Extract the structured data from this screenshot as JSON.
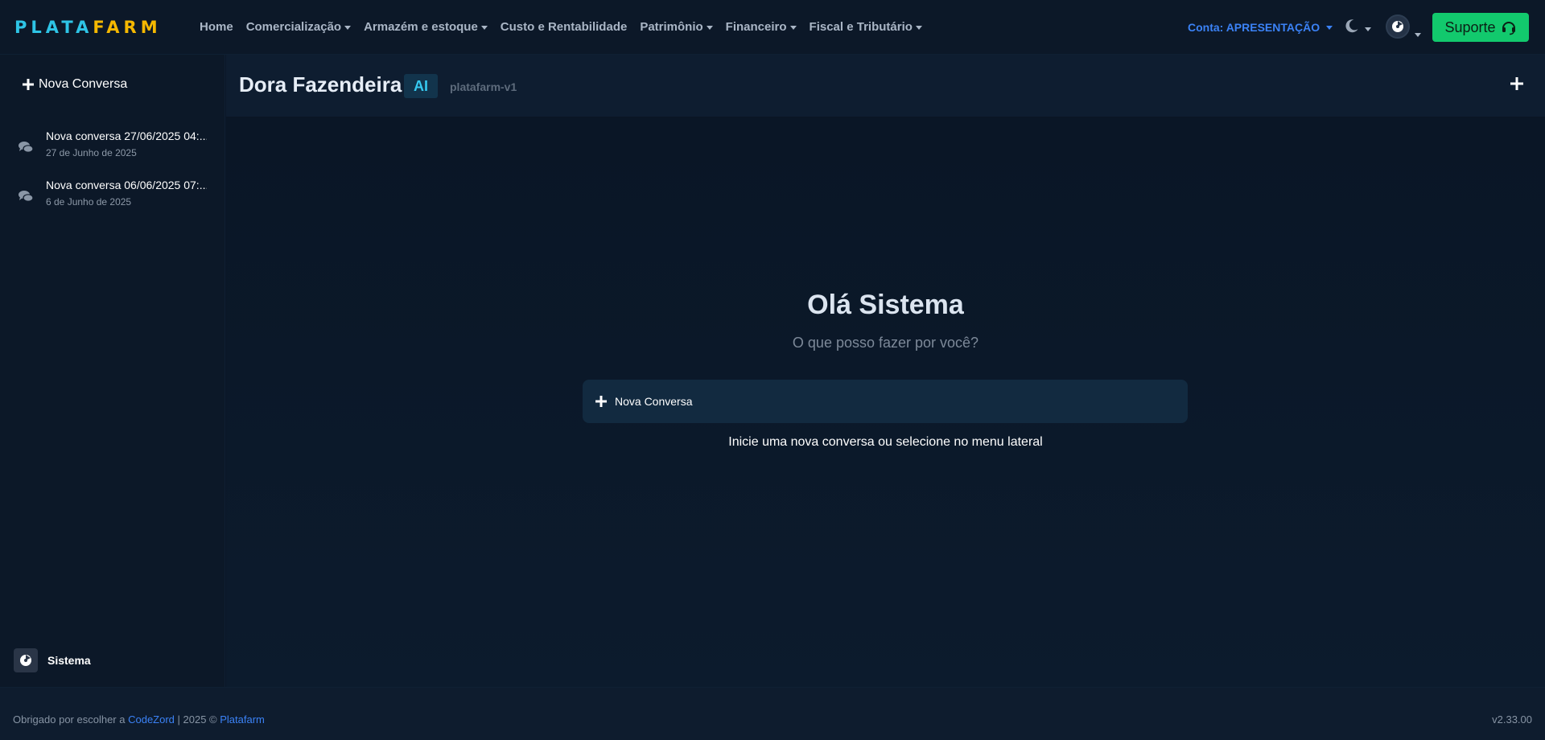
{
  "brand": {
    "part1": "PLATA",
    "part2": "FARM"
  },
  "nav": {
    "items": [
      {
        "label": "Home",
        "dropdown": false
      },
      {
        "label": "Comercialização",
        "dropdown": true
      },
      {
        "label": "Armazém e estoque",
        "dropdown": true
      },
      {
        "label": "Custo e Rentabilidade",
        "dropdown": false
      },
      {
        "label": "Patrimônio",
        "dropdown": true
      },
      {
        "label": "Financeiro",
        "dropdown": true
      },
      {
        "label": "Fiscal e Tributário",
        "dropdown": true
      }
    ],
    "account_label": "Conta: APRESENTAÇÃO",
    "support_label": "Suporte"
  },
  "sidebar": {
    "new_conversation_label": "Nova Conversa",
    "conversations": [
      {
        "title": "Nova conversa 27/06/2025 04:...",
        "date": "27 de Junho de 2025"
      },
      {
        "title": "Nova conversa 06/06/2025 07:...",
        "date": "6 de Junho de 2025"
      }
    ],
    "user_name": "Sistema"
  },
  "chat": {
    "title": "Dora Fazendeira",
    "badge": "AI",
    "model": "platafarm-v1",
    "greeting": "Olá Sistema",
    "subtitle": "O que posso fazer por você?",
    "new_conversation_label": "Nova Conversa",
    "hint": "Inicie uma nova conversa ou selecione no menu lateral"
  },
  "footer": {
    "prefix": "Obrigado por escolher a ",
    "company": "CodeZord",
    "middle": " | 2025 © ",
    "product": "Platafarm",
    "version": "v2.33.00"
  },
  "colors": {
    "brand_cyan": "#2ec4e6",
    "brand_yellow": "#f5b800",
    "accent_blue": "#3b82f6",
    "support_green": "#12c96d",
    "background": "#0b1627"
  },
  "icons": {
    "theme": "moon-icon",
    "support": "headset-icon",
    "conversation": "comments-icon",
    "add": "plus-icon"
  }
}
